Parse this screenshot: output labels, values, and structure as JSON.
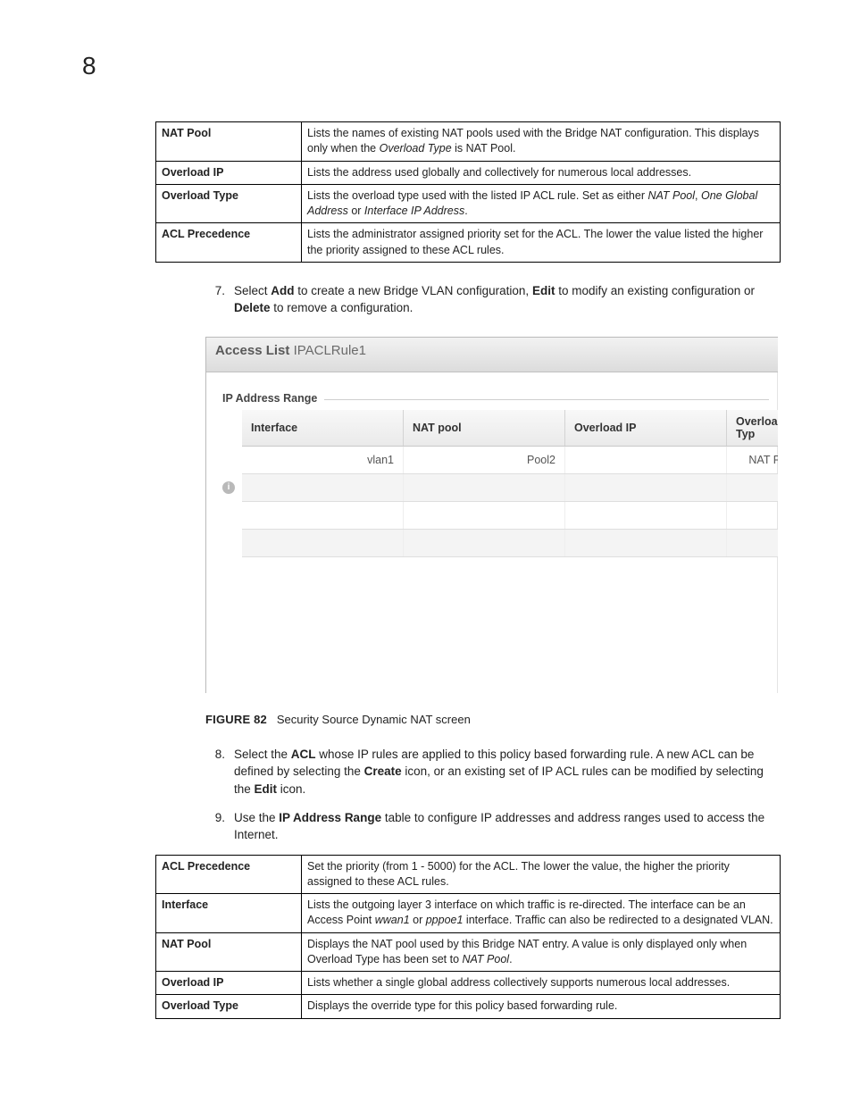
{
  "chapter_number": "8",
  "table1": {
    "rows": [
      {
        "label": "NAT Pool",
        "text_a": "Lists the names of existing NAT pools used with the Bridge NAT configuration. This displays only when the ",
        "em_a": "Overload Type",
        "text_b": " is NAT Pool."
      },
      {
        "label": "Overload IP",
        "text_a": "Lists the address used globally and collectively for numerous local addresses."
      },
      {
        "label": "Overload Type",
        "text_a": "Lists the overload type used with the listed IP ACL rule. Set as either ",
        "em_a": "NAT Pool",
        "text_b": ", ",
        "em_b": "One Global Address",
        "text_c": " or ",
        "em_c": "Interface IP Address",
        "text_d": "."
      },
      {
        "label": "ACL Precedence",
        "text_a": "Lists the administrator assigned priority set for the ACL. The lower the value listed the higher the priority assigned to these ACL rules."
      }
    ]
  },
  "step7": {
    "num": "7.",
    "pre": "Select ",
    "b1": "Add",
    "mid1": " to create a new Bridge VLAN configuration, ",
    "b2": "Edit",
    "mid2": " to modify an existing configuration or ",
    "b3": "Delete",
    "post": " to remove a configuration."
  },
  "ui": {
    "title_bold": "Access List",
    "title_value": "IPACLRule1",
    "section_label": "IP Address Range",
    "cols": {
      "c1": "Interface",
      "c2": "NAT pool",
      "c3": "Overload IP",
      "c4": "Overload Typ"
    },
    "row1": {
      "c1": "vlan1",
      "c2": "Pool2",
      "c3": "",
      "c4": "NAT Po"
    },
    "info_icon_glyph": "i"
  },
  "figure_caption": {
    "label": "FIGURE 82",
    "text": "Security Source Dynamic NAT screen"
  },
  "step8": {
    "num": "8.",
    "p1": "Select the ",
    "b1": "ACL",
    "p2": " whose IP rules are applied to this policy based forwarding rule. A new ACL can be defined by selecting the ",
    "b2": "Create",
    "p3": " icon, or an existing set of IP ACL rules can be modified by selecting the ",
    "b3": "Edit",
    "p4": " icon."
  },
  "step9": {
    "num": "9.",
    "p1": "Use the ",
    "b1": "IP Address Range",
    "p2": " table to configure IP addresses and address ranges used to access the Internet."
  },
  "table2": {
    "rows": [
      {
        "label": "ACL Precedence",
        "text_a": "Set the priority (from 1 - 5000) for the ACL. The lower the value, the higher the priority assigned to these ACL rules."
      },
      {
        "label": "Interface",
        "text_a": "Lists the outgoing layer 3 interface on which traffic is re-directed. The interface can be an Access Point ",
        "em_a": "wwan1",
        "text_b": " or ",
        "em_b": "pppoe1",
        "text_c": " interface. Traffic can also be redirected to a designated VLAN."
      },
      {
        "label": "NAT Pool",
        "text_a": "Displays the NAT pool used by this Bridge NAT entry. A value is only displayed only when Overload Type has been set to ",
        "em_a": "NAT Pool",
        "text_b": "."
      },
      {
        "label": "Overload IP",
        "text_a": "Lists whether a single global address collectively supports numerous local addresses."
      },
      {
        "label": "Overload Type",
        "text_a": "Displays the override type for this policy based forwarding rule."
      }
    ]
  }
}
